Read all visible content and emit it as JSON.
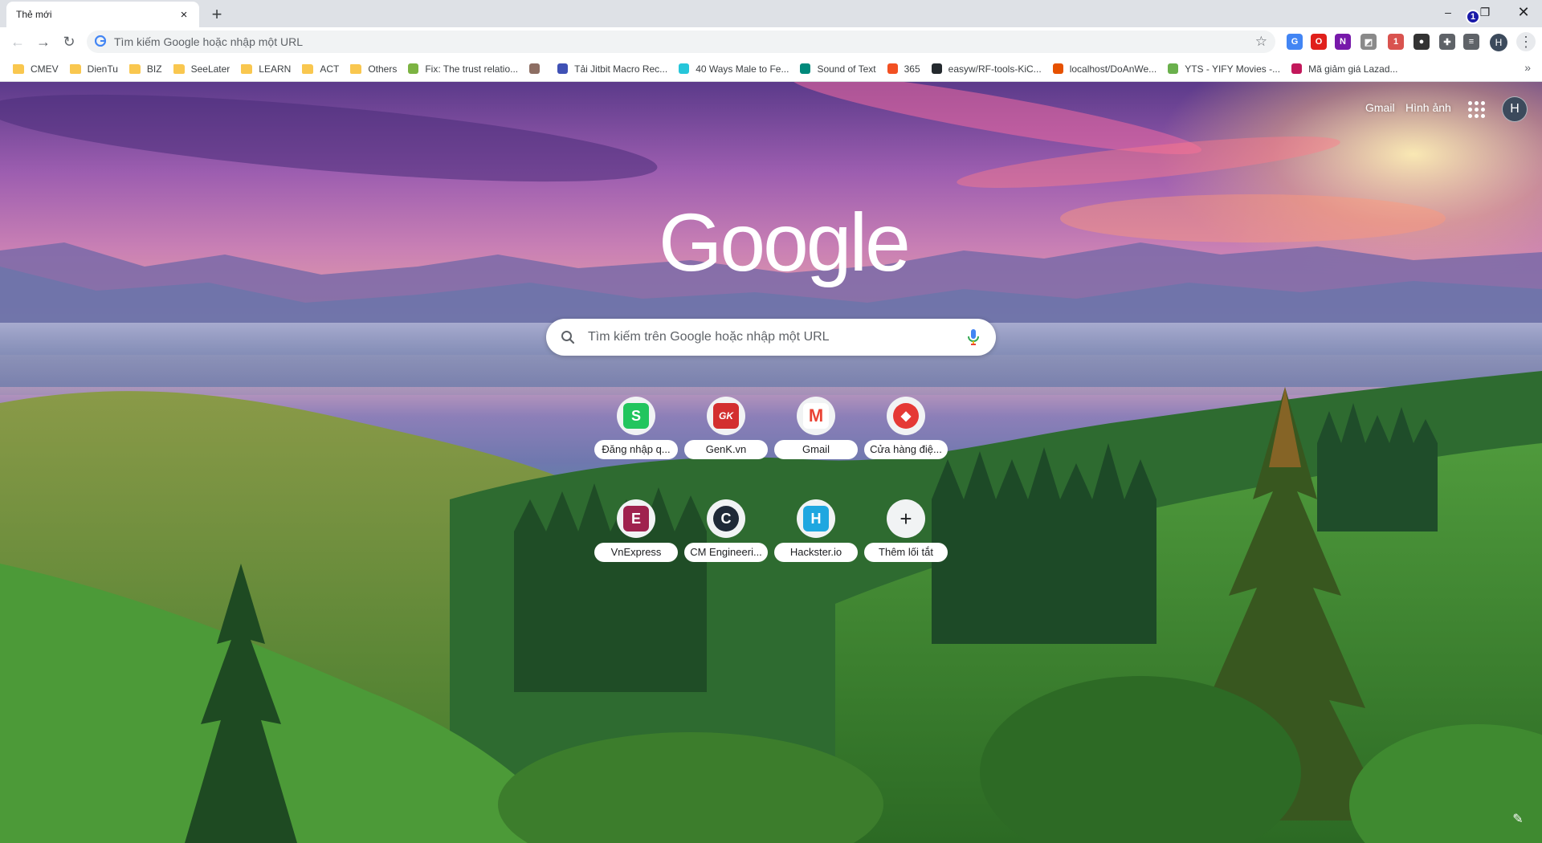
{
  "tab": {
    "title": "Thẻ mới",
    "close": "×",
    "new_tab": "+"
  },
  "window": {
    "minimize": "–",
    "maximize": "❐",
    "close": "✕",
    "badge": "1"
  },
  "toolbar": {
    "back": "←",
    "forward": "→",
    "reload": "↻",
    "omnibox_placeholder": "Tìm kiếm Google hoặc nhập một URL",
    "star": "☆",
    "profile_initial": "H",
    "menu": "⋮"
  },
  "extensions": [
    {
      "name": "translate-extension-icon",
      "color": "#4285f4",
      "glyph": "G"
    },
    {
      "name": "opera-extension-icon",
      "color": "#e0201b",
      "glyph": "O"
    },
    {
      "name": "onenote-extension-icon",
      "color": "#7719aa",
      "glyph": "N"
    },
    {
      "name": "screenshot-extension-icon",
      "color": "#8a8a8a",
      "glyph": "◩"
    },
    {
      "name": "flags-extension-icon",
      "color": "#d9534f",
      "glyph": "1"
    },
    {
      "name": "group-extension-icon",
      "color": "#333333",
      "glyph": "●"
    },
    {
      "name": "puzzle-extension-icon",
      "color": "#5f6368",
      "glyph": "✚"
    },
    {
      "name": "reading-list-icon",
      "color": "#5f6368",
      "glyph": "≡"
    }
  ],
  "bookmarks": [
    {
      "label": "CMEV",
      "type": "folder",
      "color": "#f9c74f"
    },
    {
      "label": "DienTu",
      "type": "folder",
      "color": "#f9c74f"
    },
    {
      "label": "BIZ",
      "type": "folder",
      "color": "#f9c74f"
    },
    {
      "label": "SeeLater",
      "type": "folder",
      "color": "#f9c74f"
    },
    {
      "label": "LEARN",
      "type": "folder",
      "color": "#f9c74f"
    },
    {
      "label": "ACT",
      "type": "folder",
      "color": "#f9c74f"
    },
    {
      "label": "Others",
      "type": "folder",
      "color": "#f9c74f"
    },
    {
      "label": "Fix: The trust relatio...",
      "type": "link",
      "color": "#7cb342"
    },
    {
      "label": "",
      "type": "link",
      "color": "#8d6e63"
    },
    {
      "label": "Tải Jitbit Macro Rec...",
      "type": "link",
      "color": "#3f51b5"
    },
    {
      "label": "40 Ways Male to Fe...",
      "type": "link",
      "color": "#26c6da"
    },
    {
      "label": "Sound of Text",
      "type": "link",
      "color": "#00897b"
    },
    {
      "label": "365",
      "type": "link",
      "color": "#f25022"
    },
    {
      "label": "easyw/RF-tools-KiC...",
      "type": "link",
      "color": "#24292e"
    },
    {
      "label": "localhost/DoAnWe...",
      "type": "link",
      "color": "#e65100"
    },
    {
      "label": "YTS - YIFY Movies -...",
      "type": "link",
      "color": "#6ab04c"
    },
    {
      "label": "Mã giảm giá Lazad...",
      "type": "link",
      "color": "#c2185b"
    }
  ],
  "bookmarks_more": "»",
  "ntp": {
    "gmail": "Gmail",
    "images": "Hình ảnh",
    "avatar_initial": "H",
    "logo": "Google",
    "search_placeholder": "Tìm kiếm trên Google hoặc nhập một URL",
    "customize": "✎"
  },
  "shortcuts": [
    {
      "label": "Đăng nhập q...",
      "glyph": "S",
      "bg": "#22c55e",
      "icon": "s-logo-icon"
    },
    {
      "label": "GenK.vn",
      "glyph": "GK",
      "bg": "#d32f2f",
      "icon": "genk-logo-icon"
    },
    {
      "label": "Gmail",
      "glyph": "M",
      "bg": "#ffffff",
      "icon": "gmail-logo-icon"
    },
    {
      "label": "Cửa hàng điệ...",
      "glyph": "◆",
      "bg": "#e53935",
      "icon": "store-logo-icon"
    },
    {
      "label": "VnExpress",
      "glyph": "E",
      "bg": "#9f224e",
      "icon": "vnexpress-logo-icon"
    },
    {
      "label": "CM Engineeri...",
      "glyph": "C",
      "bg": "#1f2937",
      "icon": "cm-engineering-logo-icon"
    },
    {
      "label": "Hackster.io",
      "glyph": "H",
      "bg": "#1fa7e0",
      "icon": "hackster-logo-icon"
    },
    {
      "label": "Thêm lối tắt",
      "glyph": "+",
      "bg": "#f1f3f4",
      "icon": "add-shortcut-icon"
    }
  ]
}
